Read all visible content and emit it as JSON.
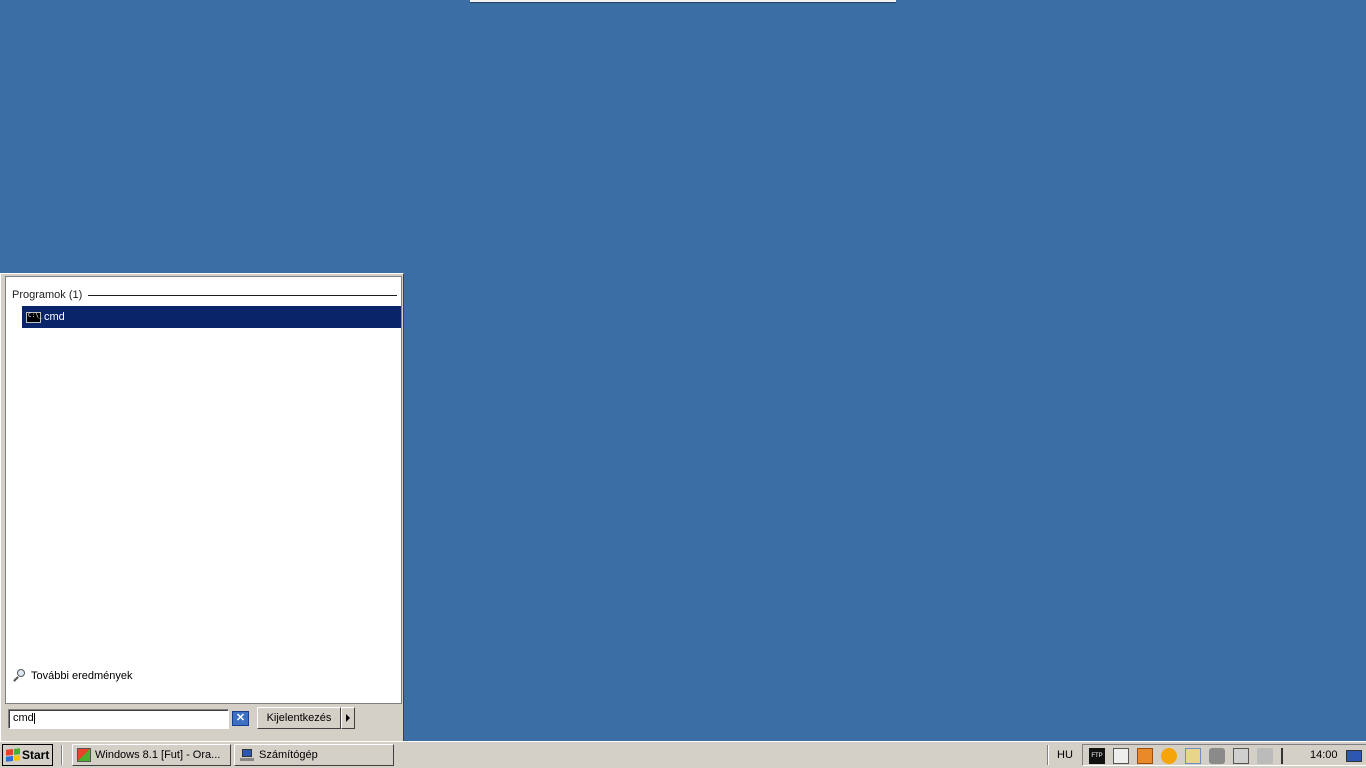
{
  "start_menu": {
    "group_header": "Programok (1)",
    "result_label": "cmd",
    "more_results": "További eredmények",
    "search_value": "cmd",
    "logoff_label": "Kijelentkezés"
  },
  "taskbar": {
    "start_label": "Start",
    "tasks": [
      {
        "label": "Windows 8.1 [Fut] - Ora..."
      },
      {
        "label": "Számítógép"
      }
    ],
    "language": "HU",
    "tray_icons": [
      "ftp-icon",
      "media-sync-icon",
      "app-orange-icon",
      "circle-orange-icon",
      "folder-sync-icon",
      "shield-check-icon",
      "network-icon",
      "volume-muted-icon",
      "action-center-flag-icon"
    ],
    "clock": "14:00"
  },
  "colors": {
    "desktop": "#3a6ea5",
    "selection": "#0a246a",
    "chrome": "#d4d0c8"
  }
}
